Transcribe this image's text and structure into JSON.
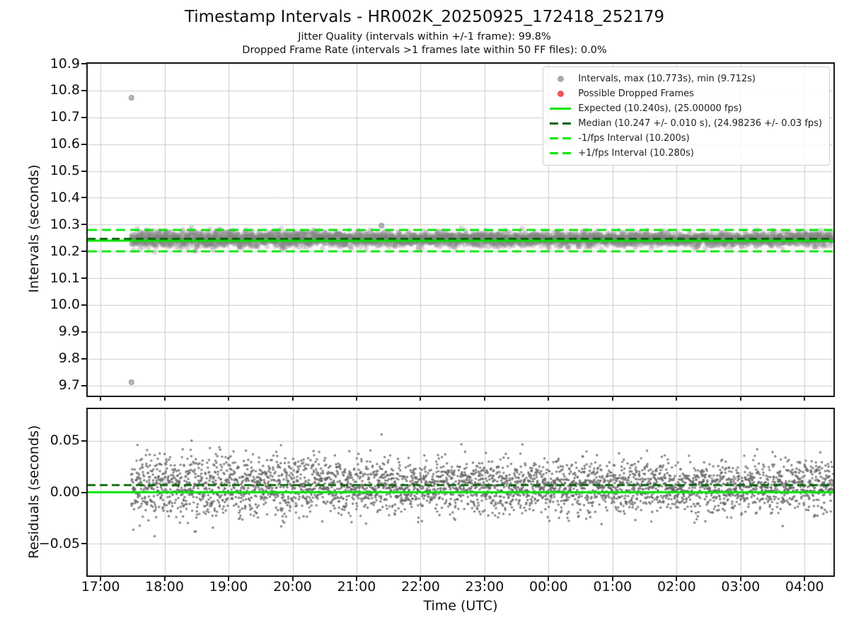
{
  "header": {
    "title": "Timestamp Intervals - HR002K_20250925_172418_252179",
    "subtitle1": "Jitter Quality (intervals within +/-1 frame): 99.8%",
    "subtitle2": "Dropped Frame Rate (intervals >1 frames late within 50 FF files): 0.0%"
  },
  "colors": {
    "lime": "#00E400",
    "darkgreen": "#006400",
    "gray_marker": "#A9A9A9",
    "red_marker": "#F05454",
    "grid": "#cbcbcb",
    "spine": "#1a1a1a",
    "points_fill": "rgba(128,128,128,0.30)",
    "outlier_fill": "rgba(128,128,128,0.55)",
    "outlier_edge": "rgba(95,95,95,0.6)",
    "residual_fill": "rgba(100,100,100,0.8)"
  },
  "chart_data": {
    "type": "scatter",
    "x_axis": {
      "label": "Time (UTC)",
      "tick_labels": [
        "17:00",
        "18:00",
        "19:00",
        "20:00",
        "21:00",
        "22:00",
        "23:00",
        "00:00",
        "01:00",
        "02:00",
        "03:00",
        "04:00"
      ],
      "tick_hours": [
        0,
        1,
        2,
        3,
        4,
        5,
        6,
        7,
        8,
        9,
        10,
        11
      ],
      "xlim_hours": [
        -0.2,
        11.45
      ],
      "grid": true
    },
    "panels": [
      {
        "name": "intervals",
        "ylabel": "Intervals (seconds)",
        "ylim": [
          9.662,
          10.9
        ],
        "yticks": [
          10.9,
          10.8,
          10.7,
          10.6,
          10.5,
          10.4,
          10.3,
          10.2,
          10.1,
          10.0,
          9.9,
          9.8,
          9.7
        ],
        "ytick_labels": [
          "10.9",
          "10.8",
          "10.7",
          "10.6",
          "10.5",
          "10.4",
          "10.3",
          "10.2",
          "10.1",
          "10.0",
          "9.9",
          "9.8",
          "9.7"
        ],
        "points_gen": {
          "n": 3800,
          "t_start_hours": 0.48,
          "t_end_hours": 11.45,
          "mean": 10.2455,
          "sd": 0.0125,
          "sd_early_extra": 0.005,
          "early_decay_hours": 1.6,
          "seed": 1337
        },
        "outliers": [
          {
            "t_hours": 0.483,
            "value": 10.773
          },
          {
            "t_hours": 0.483,
            "value": 9.712
          },
          {
            "t_hours": 4.39,
            "value": 10.296
          }
        ],
        "reference_lines": [
          {
            "name": "expected",
            "value": 10.24,
            "style": "solid",
            "color_key": "lime"
          },
          {
            "name": "median",
            "value": 10.247,
            "style": "dashed",
            "color_key": "darkgreen"
          },
          {
            "name": "minus_1fps",
            "value": 10.2,
            "style": "dashed",
            "color_key": "lime"
          },
          {
            "name": "plus_1fps",
            "value": 10.28,
            "style": "dashed",
            "color_key": "lime"
          }
        ],
        "stats": {
          "max": "10.773s",
          "min": "9.712s",
          "expected": "10.240s",
          "expected_fps": "25.00000 fps",
          "median": "10.247 +/- 0.010 s",
          "median_fps": "24.98236 +/- 0.03 fps",
          "minus_1fps": "10.200s",
          "plus_1fps": "10.280s"
        }
      },
      {
        "name": "residuals",
        "ylabel": "Residuals (seconds)",
        "ylim": [
          -0.0805,
          0.0805
        ],
        "yticks": [
          0.05,
          0.0,
          -0.05
        ],
        "ytick_labels": [
          "0.05",
          "0.00",
          "−0.05"
        ],
        "derived_from": "interval minus expected (10.240s)",
        "reference_lines": [
          {
            "name": "zero",
            "value": 0.0,
            "style": "solid",
            "color_key": "lime"
          },
          {
            "name": "median_residual",
            "value": 0.007,
            "style": "dashed",
            "color_key": "darkgreen"
          }
        ]
      }
    ],
    "legend": [
      {
        "marker": "dot",
        "color_key": "gray_marker",
        "label": "Intervals, max (10.773s), min (9.712s)"
      },
      {
        "marker": "dot",
        "color_key": "red_marker",
        "label": "Possible Dropped Frames"
      },
      {
        "marker": "solid-line",
        "color_key": "lime",
        "label": "Expected (10.240s), (25.00000 fps)"
      },
      {
        "marker": "dashed-line",
        "color_key": "darkgreen",
        "label": "Median (10.247 +/- 0.010 s), (24.98236 +/- 0.03 fps)"
      },
      {
        "marker": "dashed-line",
        "color_key": "lime",
        "label": "-1/fps Interval (10.200s)"
      },
      {
        "marker": "dashed-line",
        "color_key": "lime",
        "label": "+1/fps Interval (10.280s)"
      }
    ]
  }
}
